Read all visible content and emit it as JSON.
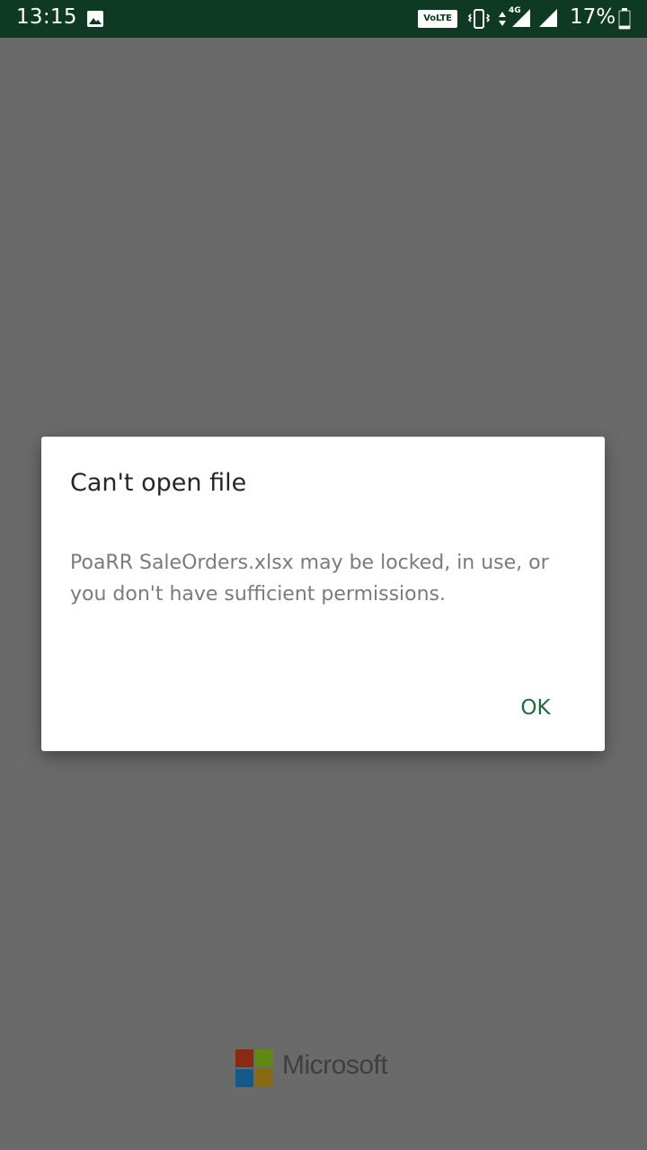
{
  "status_bar": {
    "time": "13:15",
    "volte_label": "VoLTE",
    "network_type": "4G",
    "battery_percent": "17%",
    "battery_level": 0.17,
    "icons": [
      "gallery-icon",
      "volte-badge",
      "vibrate-icon",
      "data-arrows-icon",
      "signal-icon",
      "signal-icon",
      "battery-icon"
    ]
  },
  "dialog": {
    "title": "Can't open file",
    "message": "PoaRR SaleOrders.xlsx may be locked, in use, or you don't have sufficient permissions.",
    "ok_label": "OK",
    "accent_color": "#1e6b3c"
  },
  "branding": {
    "wordmark": "Microsoft",
    "logo_colors": [
      "#8b2a12",
      "#5f8a12",
      "#135a8a",
      "#8a6a10"
    ]
  },
  "colors": {
    "status_bar_bg": "#0e3a23",
    "scrim_bg": "#6a6a6a"
  }
}
